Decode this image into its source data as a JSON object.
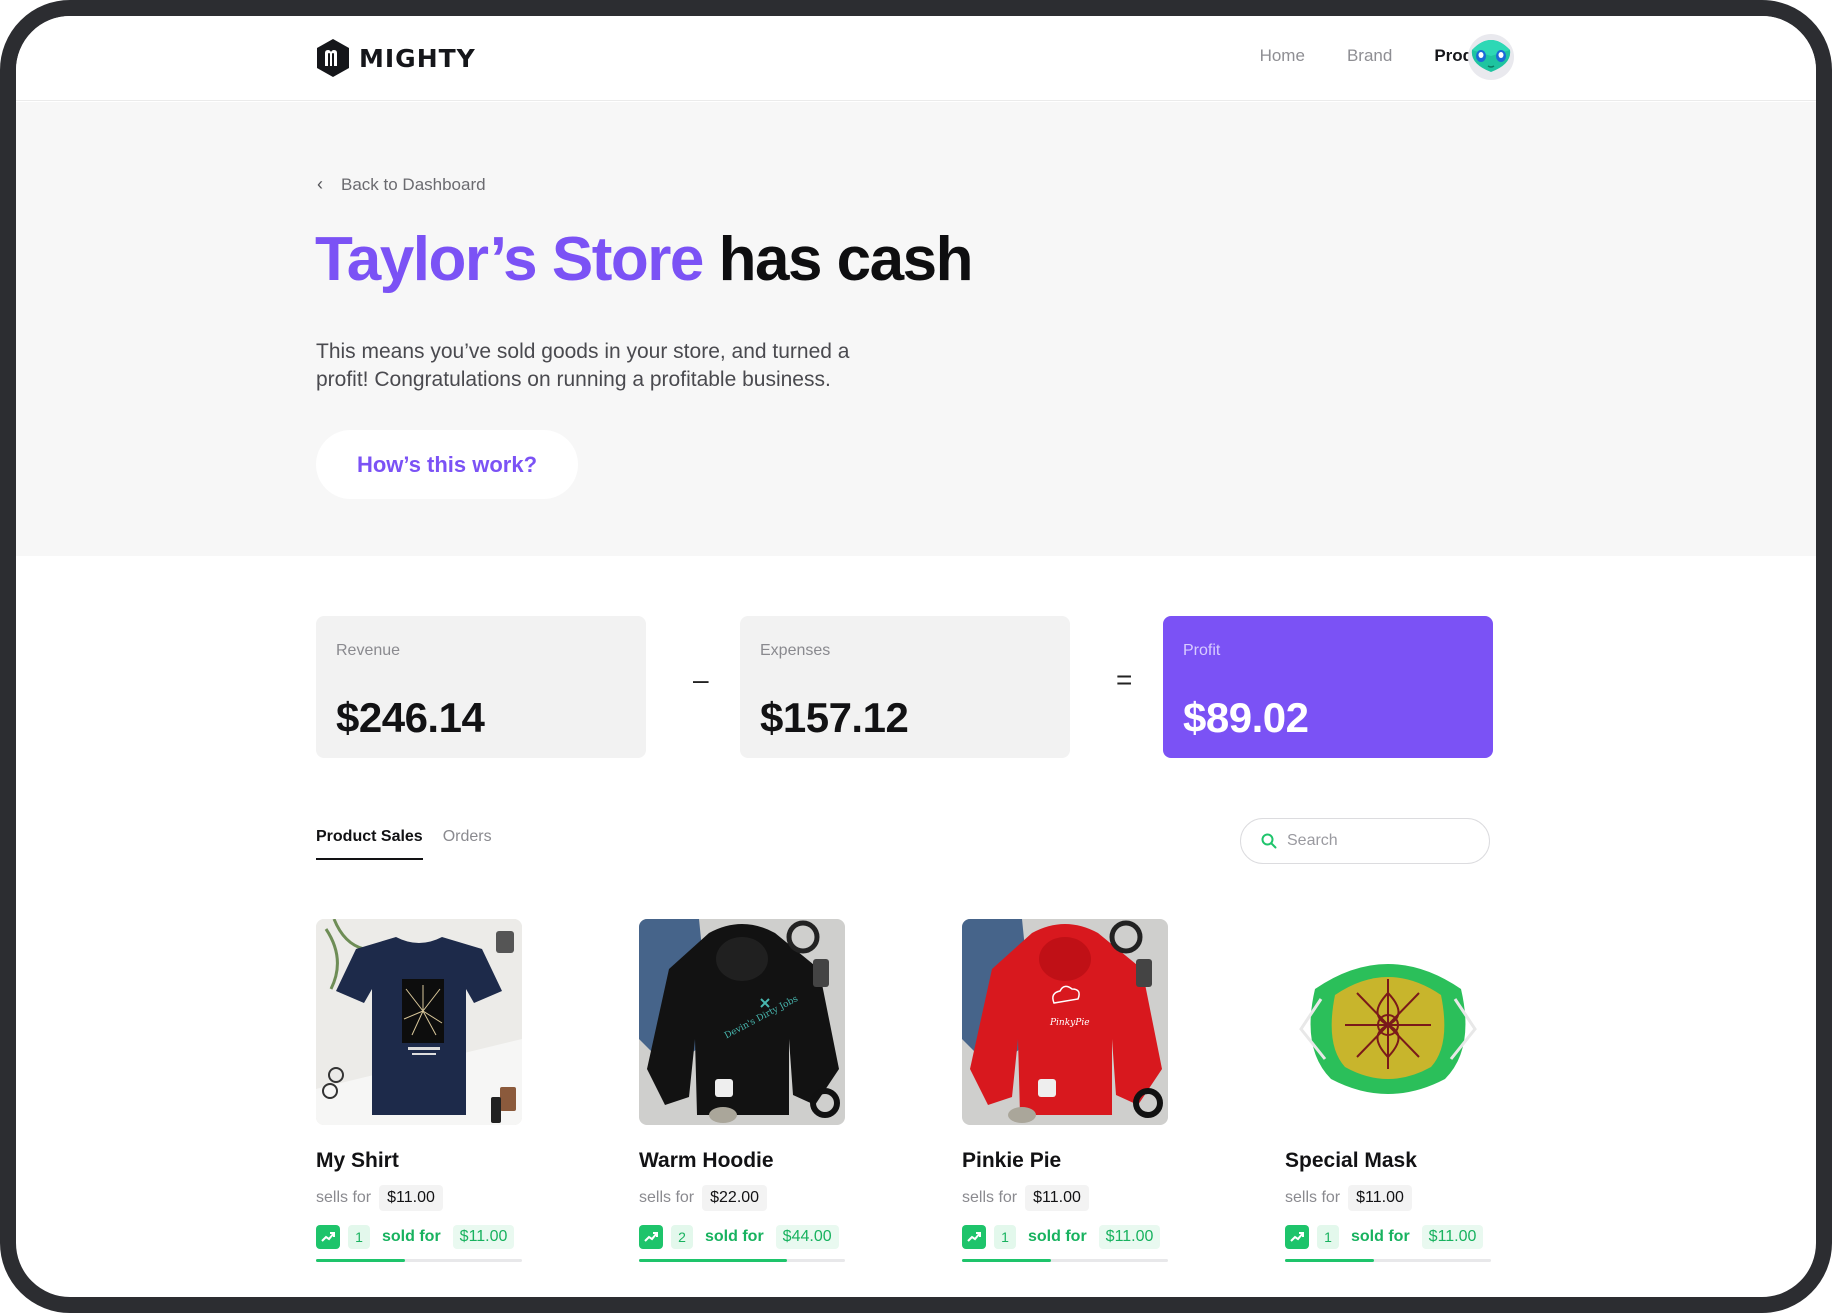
{
  "brand": {
    "name": "MIGHTY"
  },
  "nav": {
    "links": [
      {
        "label": "Home"
      },
      {
        "label": "Brand"
      },
      {
        "label": "Products"
      }
    ],
    "active": "Products"
  },
  "hero": {
    "back_label": "Back to Dashboard",
    "title_accent": "Taylor’s Store",
    "title_rest": "has cash",
    "description": "This means you’ve sold goods in your store, and turned a profit! Congratulations on running a profitable business.",
    "cta_label": "How’s this work?"
  },
  "stats": {
    "revenue": {
      "label": "Revenue",
      "value": "$246.14"
    },
    "minus": "–",
    "expenses": {
      "label": "Expenses",
      "value": "$157.12"
    },
    "equals": "=",
    "profit": {
      "label": "Profit",
      "value": "$89.02"
    }
  },
  "tabs": [
    {
      "label": "Product Sales"
    },
    {
      "label": "Orders"
    }
  ],
  "search": {
    "placeholder": "Search"
  },
  "products": [
    {
      "name": "My Shirt",
      "sells_label": "sells for",
      "price": "$11.00",
      "qty": "1",
      "sold_label": "sold for",
      "sold_amount": "$11.00",
      "sales_progress": 0.43
    },
    {
      "name": "Warm Hoodie",
      "sells_label": "sells for",
      "price": "$22.00",
      "qty": "2",
      "sold_label": "sold for",
      "sold_amount": "$44.00",
      "sales_progress": 0.72
    },
    {
      "name": "Pinkie Pie",
      "sells_label": "sells for",
      "price": "$11.00",
      "qty": "1",
      "sold_label": "sold for",
      "sold_amount": "$11.00",
      "sales_progress": 0.43
    },
    {
      "name": "Special Mask",
      "sells_label": "sells for",
      "price": "$11.00",
      "qty": "1",
      "sold_label": "sold for",
      "sold_amount": "$11.00",
      "sales_progress": 0.43
    }
  ],
  "colors": {
    "accent": "#7b52f5",
    "success": "#1ec46b",
    "frame": "#2c2d31"
  }
}
